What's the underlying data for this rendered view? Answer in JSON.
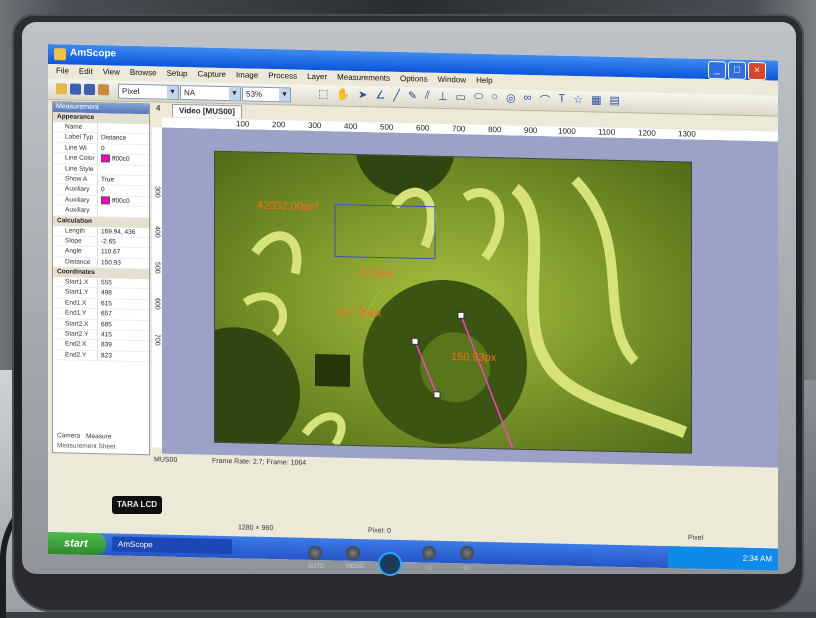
{
  "window": {
    "title": "AmScope",
    "min": "_",
    "max": "□",
    "close": "×"
  },
  "menu": [
    "File",
    "Edit",
    "View",
    "Browse",
    "Setup",
    "Capture",
    "Image",
    "Process",
    "Layer",
    "Measurements",
    "Options",
    "Window",
    "Help"
  ],
  "toolbar": {
    "unit": "Pixel",
    "mode": "NA",
    "zoom": "53%"
  },
  "left_panel": {
    "header": "Measurement",
    "appearance_title": "Appearance",
    "appearance": [
      {
        "k": "Name",
        "v": ""
      },
      {
        "k": "Label Typ",
        "v": "Distance"
      },
      {
        "k": "Line Wi",
        "v": "0"
      },
      {
        "k": "Line Color",
        "v": "ff00c0",
        "swatch": true
      },
      {
        "k": "Line Style",
        "v": ""
      },
      {
        "k": "Show A",
        "v": "True"
      },
      {
        "k": "Auxiliary",
        "v": "0"
      },
      {
        "k": "Auxiliary",
        "v": "ff00c0",
        "swatch": true
      },
      {
        "k": "Auxiliary",
        "v": ""
      }
    ],
    "calculation_title": "Calculation",
    "calculation": [
      {
        "k": "Length",
        "v": "169.94, 436"
      },
      {
        "k": "Slope",
        "v": "-2.65"
      },
      {
        "k": "Angle",
        "v": "110.67"
      },
      {
        "k": "Distance",
        "v": "150.93"
      }
    ],
    "coordinates_title": "Coordinates",
    "coordinates": [
      {
        "k": "Start1.X",
        "v": "555"
      },
      {
        "k": "Start1.Y",
        "v": "498"
      },
      {
        "k": "End1.X",
        "v": "615"
      },
      {
        "k": "End1.Y",
        "v": "657"
      },
      {
        "k": "Start2.X",
        "v": "685"
      },
      {
        "k": "Start2.Y",
        "v": "415"
      },
      {
        "k": "End2.X",
        "v": "839"
      },
      {
        "k": "End2.Y",
        "v": "823"
      }
    ],
    "tabs": [
      "Camera",
      "Measure"
    ],
    "sheet": "Measurement Sheet"
  },
  "doc": {
    "tab_index": "4",
    "tab_label": "Video [MUS00]",
    "ruler_h": [
      "100",
      "200",
      "300",
      "400",
      "500",
      "600",
      "700",
      "800",
      "900",
      "1000",
      "1100",
      "1200",
      "1300"
    ],
    "ruler_v": [
      "300",
      "400",
      "500",
      "600",
      "700"
    ]
  },
  "measurements": {
    "area": "42032.00px²",
    "small": "6.32px",
    "line": "117.00px",
    "distance": "150.93px"
  },
  "status": {
    "frame": "Frame Rate: 2.7; Frame: 1064",
    "resolution": "1280 × 960",
    "pixel": "Pixel: 0",
    "unit": "Pixel",
    "app": "MUS00"
  },
  "taskbar": {
    "start": "start",
    "app": "AmScope",
    "clock": "2:34 AM"
  },
  "monitor": {
    "brand": "TARA LCD",
    "auto": "AUTO",
    "menu": "MENU",
    "left": "◁",
    "right": "▷"
  }
}
